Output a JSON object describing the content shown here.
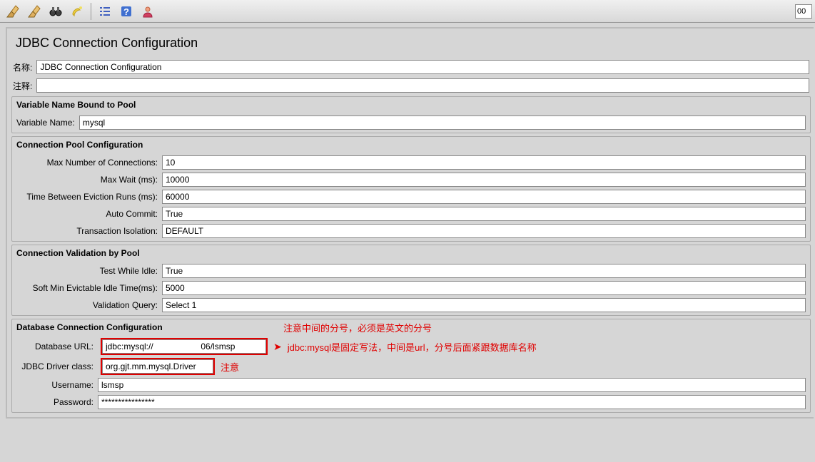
{
  "toolbar": {
    "counter": "00"
  },
  "panel": {
    "title": "JDBC Connection Configuration",
    "name_label": "名称:",
    "name_value": "JDBC Connection Configuration",
    "comments_label": "注释:",
    "comments_value": ""
  },
  "sections": {
    "var_pool": {
      "title": "Variable Name Bound to Pool",
      "var_name_label": "Variable Name:",
      "var_name_value": "mysql"
    },
    "conn_pool": {
      "title": "Connection Pool Configuration",
      "max_conn_label": "Max Number of Connections:",
      "max_conn_value": "10",
      "max_wait_label": "Max Wait (ms):",
      "max_wait_value": "10000",
      "time_evict_label": "Time Between Eviction Runs (ms):",
      "time_evict_value": "60000",
      "auto_commit_label": "Auto Commit:",
      "auto_commit_value": "True",
      "tx_iso_label": "Transaction Isolation:",
      "tx_iso_value": "DEFAULT"
    },
    "conn_valid": {
      "title": "Connection Validation by Pool",
      "test_idle_label": "Test While Idle:",
      "test_idle_value": "True",
      "soft_min_label": "Soft Min Evictable Idle Time(ms):",
      "soft_min_value": "5000",
      "valid_query_label": "Validation Query:",
      "valid_query_value": "Select 1"
    },
    "db_conn": {
      "title": "Database Connection Configuration",
      "db_url_label": "Database URL:",
      "db_url_prefix": "jdbc:mysql://",
      "db_url_suffix": "06/lsmsp",
      "driver_label": "JDBC Driver class:",
      "driver_value": "org.gjt.mm.mysql.Driver",
      "username_label": "Username:",
      "username_value": "lsmsp",
      "password_label": "Password:",
      "password_value": "****************"
    }
  },
  "annotations": {
    "top": "注意中间的分号，必须是英文的分号",
    "url": "jdbc:mysql是固定写法，中间是url，分号后面紧跟数据库名称",
    "driver": "注意"
  }
}
